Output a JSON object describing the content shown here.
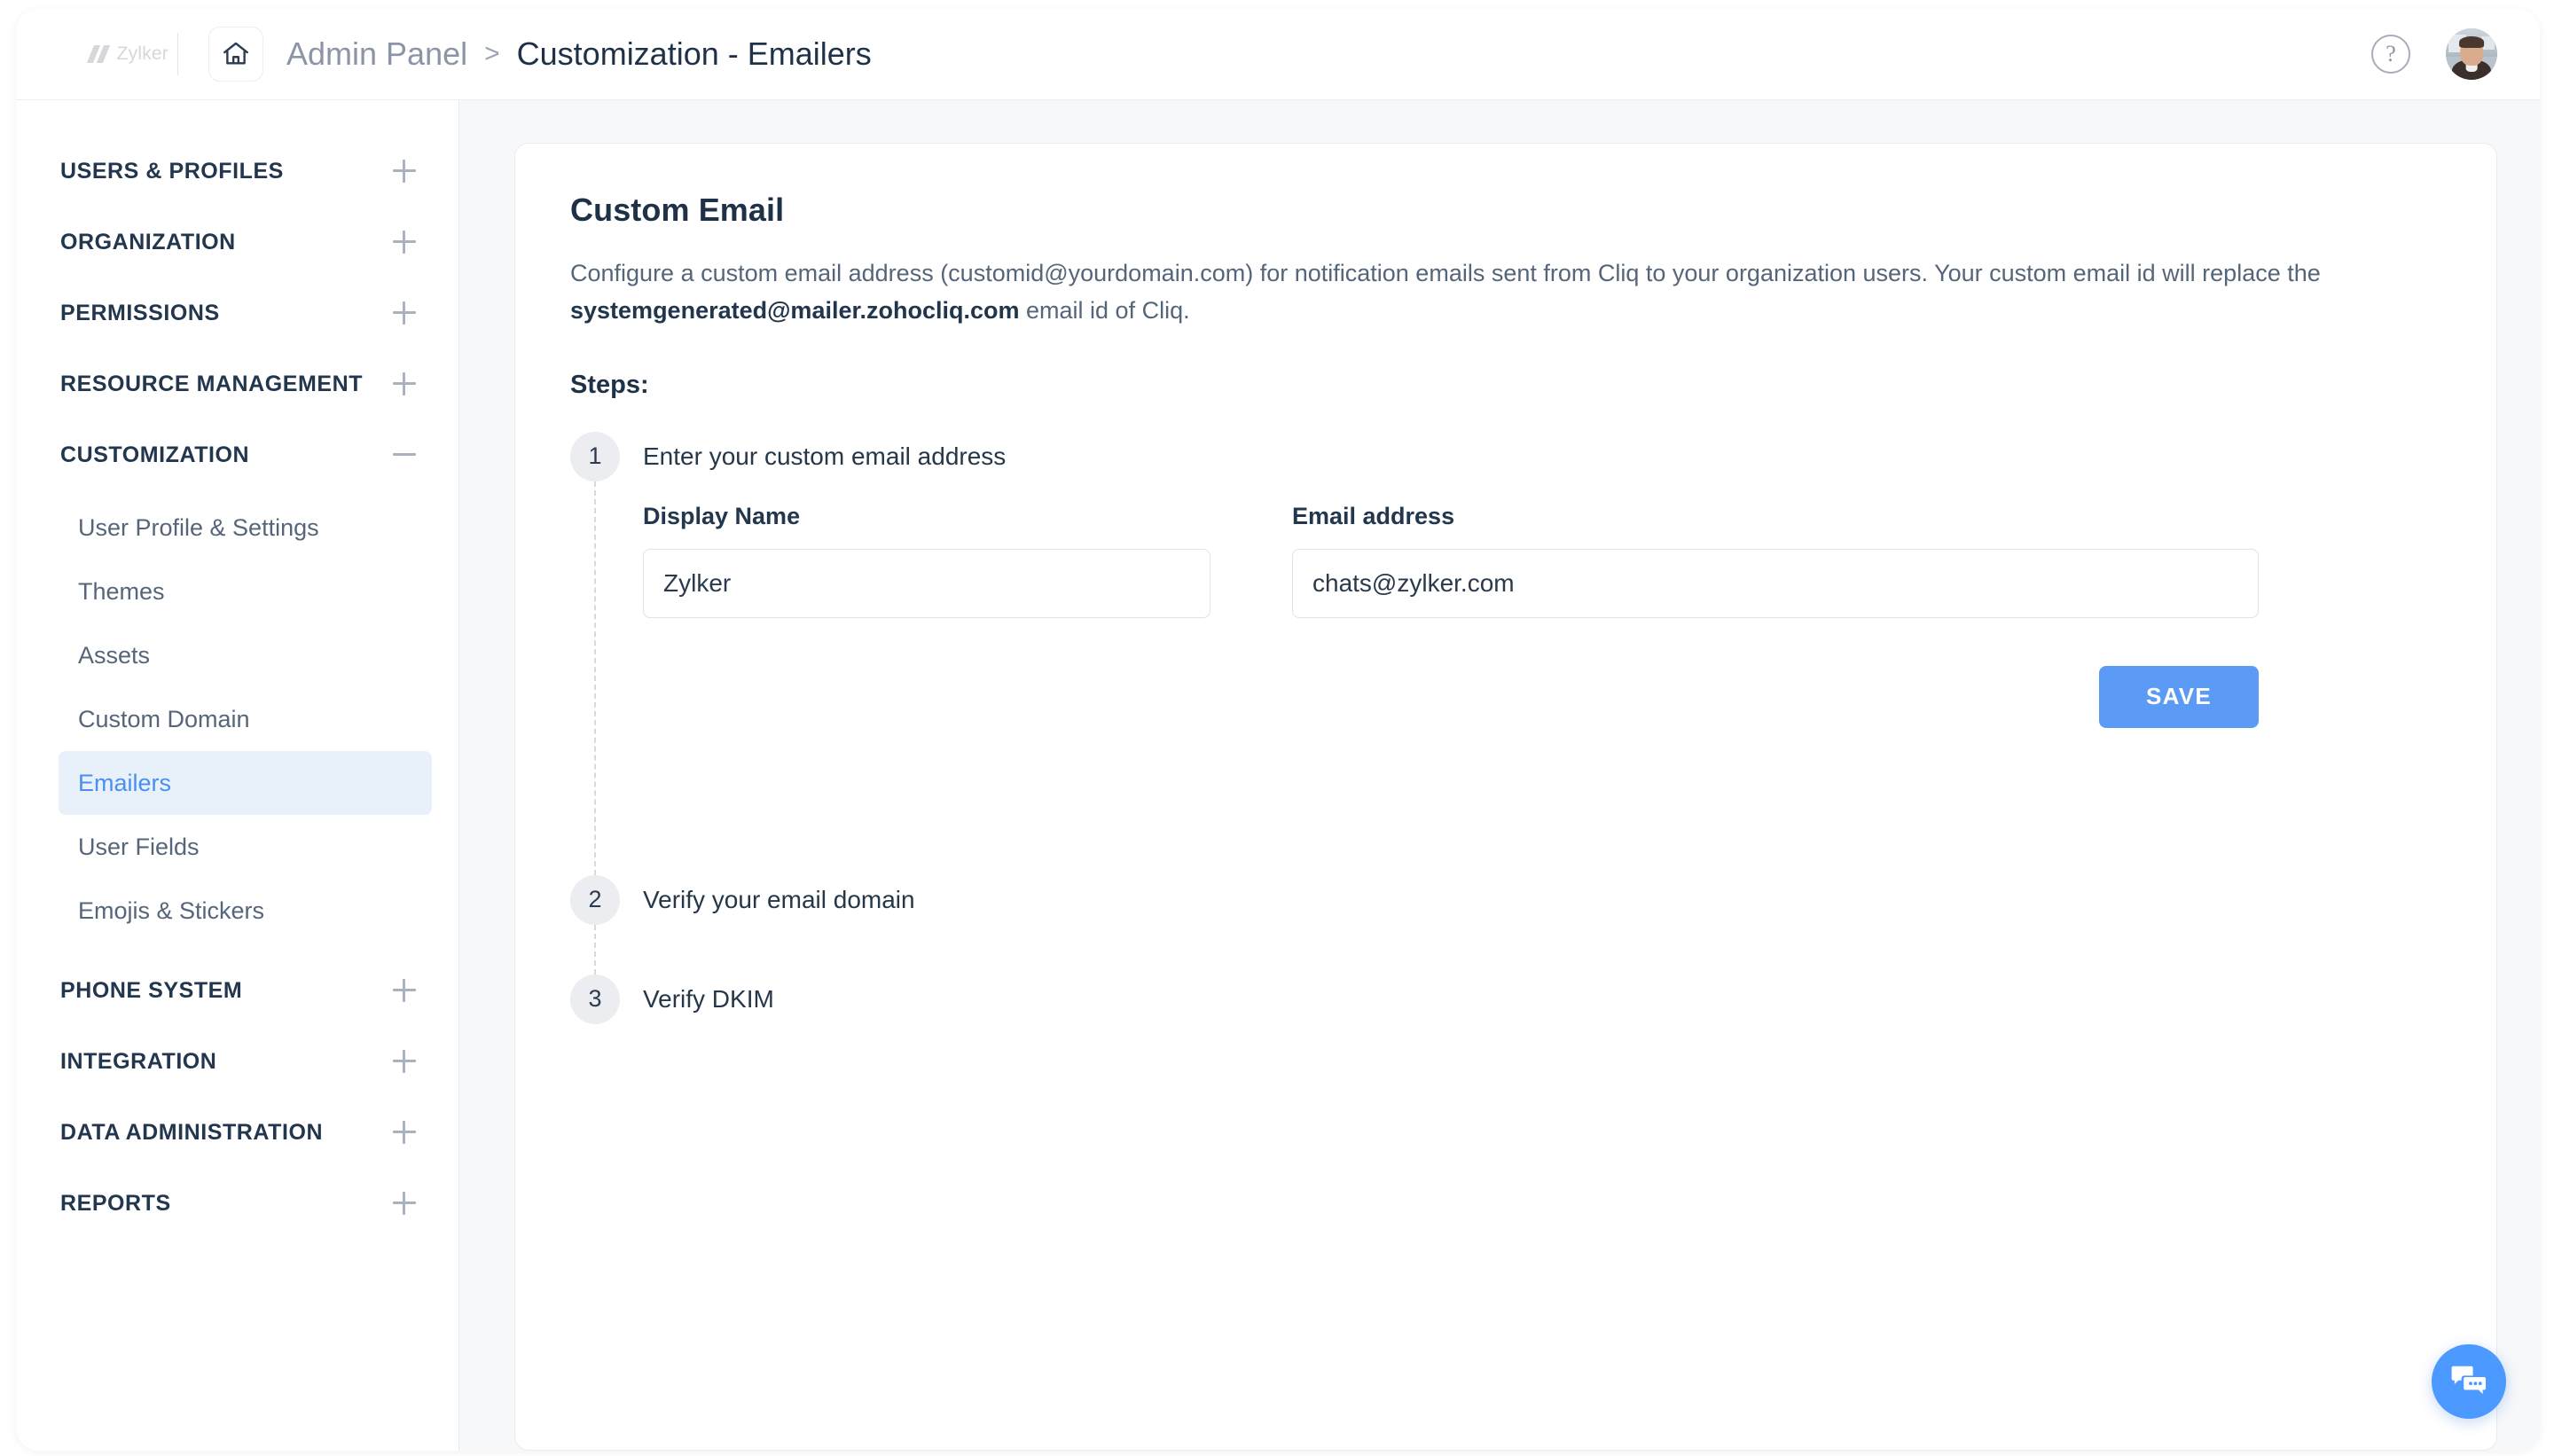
{
  "topbar": {
    "brand_name": "Zylker",
    "home_icon": "home-icon",
    "breadcrumb_root": "Admin Panel",
    "breadcrumb_separator": ">",
    "breadcrumb_current": "Customization - Emailers",
    "help_label": "?",
    "avatar_label": "user-avatar"
  },
  "sidebar": {
    "groups": [
      {
        "label": "USERS & PROFILES",
        "state": "collapsed",
        "toggle": "plus-icon"
      },
      {
        "label": "ORGANIZATION",
        "state": "collapsed",
        "toggle": "plus-icon"
      },
      {
        "label": "PERMISSIONS",
        "state": "collapsed",
        "toggle": "plus-icon"
      },
      {
        "label": "RESOURCE MANAGEMENT",
        "state": "collapsed",
        "toggle": "plus-icon"
      },
      {
        "label": "CUSTOMIZATION",
        "state": "expanded",
        "toggle": "minus-icon"
      },
      {
        "label": "PHONE SYSTEM",
        "state": "collapsed",
        "toggle": "plus-icon"
      },
      {
        "label": "INTEGRATION",
        "state": "collapsed",
        "toggle": "plus-icon"
      },
      {
        "label": "DATA ADMINISTRATION",
        "state": "collapsed",
        "toggle": "plus-icon"
      },
      {
        "label": "REPORTS",
        "state": "collapsed",
        "toggle": "plus-icon"
      }
    ],
    "customization_items": [
      {
        "label": "User Profile & Settings",
        "active": false
      },
      {
        "label": "Themes",
        "active": false
      },
      {
        "label": "Assets",
        "active": false
      },
      {
        "label": "Custom Domain",
        "active": false
      },
      {
        "label": "Emailers",
        "active": true
      },
      {
        "label": "User Fields",
        "active": false
      },
      {
        "label": "Emojis & Stickers",
        "active": false
      }
    ]
  },
  "main": {
    "title": "Custom Email",
    "description_part1": "Configure a custom email address (customid@yourdomain.com) for notification emails sent from Cliq to your organization users. Your custom email id will replace the ",
    "description_bold": "systemgenerated@mailer.zohocliq.com",
    "description_part2": " email id of Cliq.",
    "steps_label": "Steps:",
    "steps": [
      {
        "number": "1",
        "title": "Enter your custom email address"
      },
      {
        "number": "2",
        "title": "Verify your email domain"
      },
      {
        "number": "3",
        "title": "Verify DKIM"
      }
    ],
    "form": {
      "display_name_label": "Display Name",
      "display_name_value": "Zylker",
      "display_name_placeholder": "Display Name",
      "email_label": "Email address",
      "email_value": "chats@zylker.com",
      "email_placeholder": "Email address",
      "save_label": "SAVE"
    }
  },
  "floating": {
    "chat_icon": "chat-bubbles-icon"
  },
  "colors": {
    "accent": "#5b9af5",
    "active_nav_text": "#4a8ef0",
    "active_nav_bg": "#e8f0fa",
    "heading": "#1f3147",
    "body_text": "#55657a",
    "page_bg": "#f7f8fa"
  }
}
